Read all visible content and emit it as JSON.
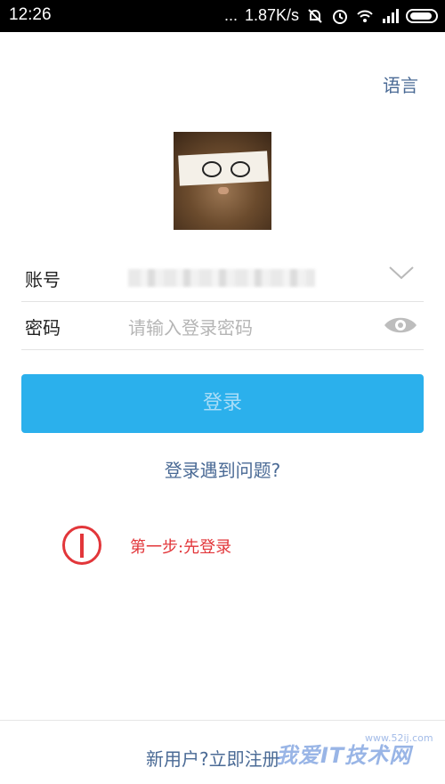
{
  "status_bar": {
    "time": "12:26",
    "dots": "...",
    "speed": "1.87K/s"
  },
  "header": {
    "language_label": "语言"
  },
  "form": {
    "account_label": "账号",
    "password_label": "密码",
    "password_placeholder": "请输入登录密码"
  },
  "login_button_label": "登录",
  "trouble_link": "登录遇到问题?",
  "annotation": {
    "text": "第一步:先登录"
  },
  "footer": {
    "register_link": "新用户?立即注册"
  },
  "watermark": {
    "text": "我爱IT技术网",
    "domain": "www.52ij.com"
  },
  "colors": {
    "accent": "#2bb0ec",
    "link": "#4a6a95",
    "annotation": "#e2363a"
  }
}
